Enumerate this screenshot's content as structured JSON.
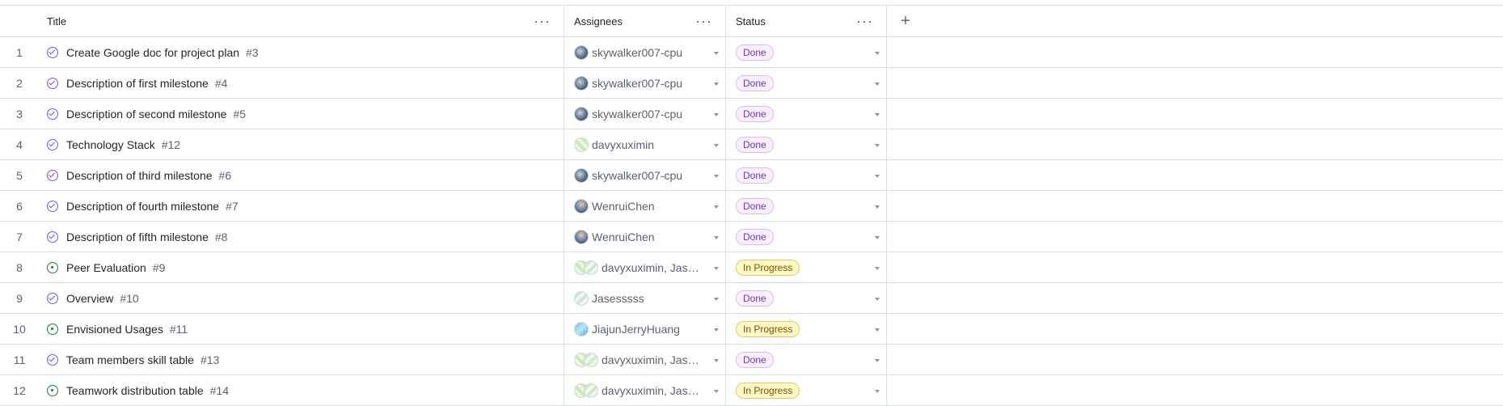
{
  "columns": {
    "title": "Title",
    "assignees": "Assignees",
    "status": "Status",
    "more": "···",
    "add": "+"
  },
  "rows": [
    {
      "num": "1",
      "state": "closed",
      "title": "Create Google doc for project plan",
      "issue": "#3",
      "assignee": "skywalker007-cpu",
      "avatars": [
        "sky"
      ],
      "status": "Done"
    },
    {
      "num": "2",
      "state": "closed",
      "title": "Description of first milestone",
      "issue": "#4",
      "assignee": "skywalker007-cpu",
      "avatars": [
        "sky"
      ],
      "status": "Done"
    },
    {
      "num": "3",
      "state": "closed",
      "title": "Description of second milestone",
      "issue": "#5",
      "assignee": "skywalker007-cpu",
      "avatars": [
        "sky"
      ],
      "status": "Done"
    },
    {
      "num": "4",
      "state": "closed",
      "title": "Technology Stack",
      "issue": "#12",
      "assignee": "davyxuximin",
      "avatars": [
        "davy"
      ],
      "status": "Done"
    },
    {
      "num": "5",
      "state": "closed",
      "title": "Description of third milestone",
      "issue": "#6",
      "assignee": "skywalker007-cpu",
      "avatars": [
        "sky"
      ],
      "status": "Done"
    },
    {
      "num": "6",
      "state": "closed",
      "title": "Description of fourth milestone",
      "issue": "#7",
      "assignee": "WenruiChen",
      "avatars": [
        "wenrui"
      ],
      "status": "Done"
    },
    {
      "num": "7",
      "state": "closed",
      "title": "Description of fifth milestone",
      "issue": "#8",
      "assignee": "WenruiChen",
      "avatars": [
        "wenrui"
      ],
      "status": "Done"
    },
    {
      "num": "8",
      "state": "open",
      "title": "Peer Evaluation",
      "issue": "#9",
      "assignee": "davyxuximin, Jases...",
      "avatars": [
        "davy",
        "jases"
      ],
      "status": "In Progress"
    },
    {
      "num": "9",
      "state": "closed",
      "title": "Overview",
      "issue": "#10",
      "assignee": "Jasesssss",
      "avatars": [
        "jases"
      ],
      "status": "Done"
    },
    {
      "num": "10",
      "state": "open",
      "title": "Envisioned Usages",
      "issue": "#11",
      "assignee": "JiajunJerryHuang",
      "avatars": [
        "jiajun"
      ],
      "status": "In Progress"
    },
    {
      "num": "11",
      "state": "closed",
      "title": "Team members skill table",
      "issue": "#13",
      "assignee": "davyxuximin, Jases...",
      "avatars": [
        "davy",
        "jases"
      ],
      "status": "Done"
    },
    {
      "num": "12",
      "state": "open",
      "title": "Teamwork distribution table",
      "issue": "#14",
      "assignee": "davyxuximin, Jases...",
      "avatars": [
        "davy",
        "jases"
      ],
      "status": "In Progress"
    }
  ],
  "colors": {
    "closed_icon": "#8250df",
    "open_icon": "#1a7f37",
    "done_badge_bg": "#fbefff",
    "done_badge_text": "#6639ba",
    "progress_badge_bg": "#fff8c5",
    "progress_badge_text": "#7d4e00",
    "border": "#d8dee4"
  }
}
